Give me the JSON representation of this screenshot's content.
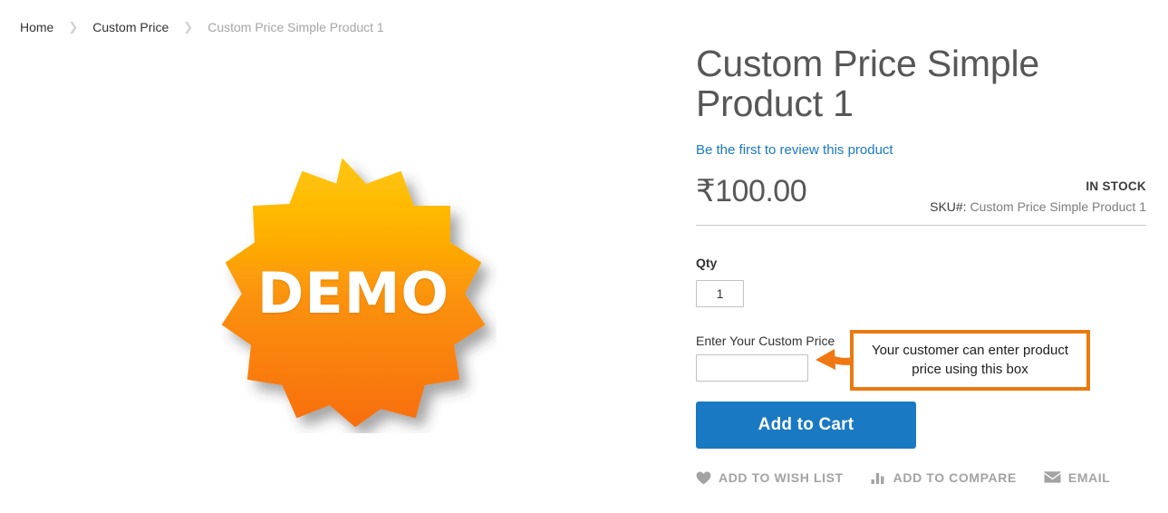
{
  "breadcrumbs": [
    {
      "label": "Home",
      "current": false
    },
    {
      "label": "Custom Price",
      "current": false
    },
    {
      "label": "Custom Price Simple Product 1",
      "current": true
    }
  ],
  "breadcrumb_separator": "❯",
  "gallery": {
    "badge_text": "DEMO",
    "badge_gradient_top": "#FFC107",
    "badge_gradient_mid": "#FB9C0C",
    "badge_gradient_bottom": "#F87208"
  },
  "product": {
    "title": "Custom Price Simple Product 1",
    "reviews_link": "Be the first to review this product",
    "price": "₹100.00",
    "stock_status": "IN STOCK",
    "sku_label": "SKU#:",
    "sku_value": "Custom Price Simple Product 1"
  },
  "form": {
    "qty_label": "Qty",
    "qty_value": "1",
    "qty_placeholder": "",
    "custom_price_label": "Enter Your Custom Price",
    "custom_price_value": "",
    "custom_price_placeholder": "",
    "add_to_cart_label": "Add to Cart"
  },
  "annotation": {
    "text": "Your customer can enter product price using this box",
    "border_color": "#ea7a10",
    "arrow_color": "#f07712"
  },
  "social": [
    {
      "label": "ADD TO WISH LIST",
      "icon": "heart-icon"
    },
    {
      "label": "ADD TO COMPARE",
      "icon": "compare-bars-icon"
    },
    {
      "label": "EMAIL",
      "icon": "envelope-icon"
    }
  ],
  "colors": {
    "link_blue": "#1979c3",
    "button_blue": "#1979c3",
    "text_dark": "#333333",
    "text_muted": "#a6a6a6"
  }
}
